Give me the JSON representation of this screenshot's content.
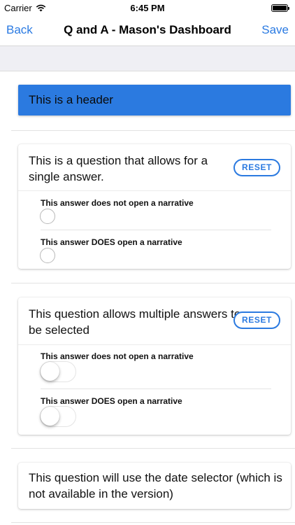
{
  "status_bar": {
    "carrier": "Carrier",
    "time": "6:45 PM"
  },
  "nav": {
    "back_label": "Back",
    "title": "Q and A - Mason's Dashboard",
    "save_label": "Save"
  },
  "header_block": {
    "text": "This is a header"
  },
  "question1": {
    "text": "This is a question that allows for a single answer.",
    "reset_label": "RESET",
    "answers": [
      {
        "label": "This answer does not open a narrative"
      },
      {
        "label": "This answer DOES open a narrative"
      }
    ]
  },
  "question2": {
    "text": "This question allows multiple answers to be selected",
    "reset_label": "RESET",
    "answers": [
      {
        "label": "This answer does not open a narrative"
      },
      {
        "label": "This answer DOES open a narrative"
      }
    ]
  },
  "question3": {
    "text": "This question will use the date selector (which is not available in the version)"
  },
  "colors": {
    "accent": "#2b7ae0",
    "header_bg": "#2b7ae0",
    "band_bg": "#efeff4"
  },
  "icons": {
    "wifi": "wifi-icon",
    "battery": "battery-icon"
  }
}
